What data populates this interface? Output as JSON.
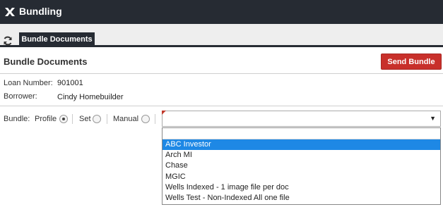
{
  "app": {
    "title": "Bundling",
    "logo_icon": "x-logo-icon"
  },
  "tabs": {
    "refresh_icon": "refresh-icon",
    "active_label": "Bundle Documents"
  },
  "page": {
    "title": "Bundle Documents",
    "send_label": "Send Bundle",
    "send_color": "#c8302b"
  },
  "loan": {
    "number_label": "Loan Number:",
    "number": "901001",
    "borrower_label": "Borrower:",
    "borrower": "Cindy Homebuilder"
  },
  "bundle": {
    "label": "Bundle:",
    "profile_label": "Profile",
    "set_label": "Set",
    "manual_label": "Manual",
    "selected_mode": "Profile",
    "select_value": "",
    "select_caret": "▼",
    "search_value": "",
    "options": [
      "ABC Investor",
      "Arch MI",
      "Chase",
      "MGIC",
      "Wells Indexed - 1 image file per doc",
      "Wells Test - Non-Indexed All one file"
    ],
    "highlighted_option": "ABC Investor",
    "highlight_color": "#1e88e5"
  }
}
